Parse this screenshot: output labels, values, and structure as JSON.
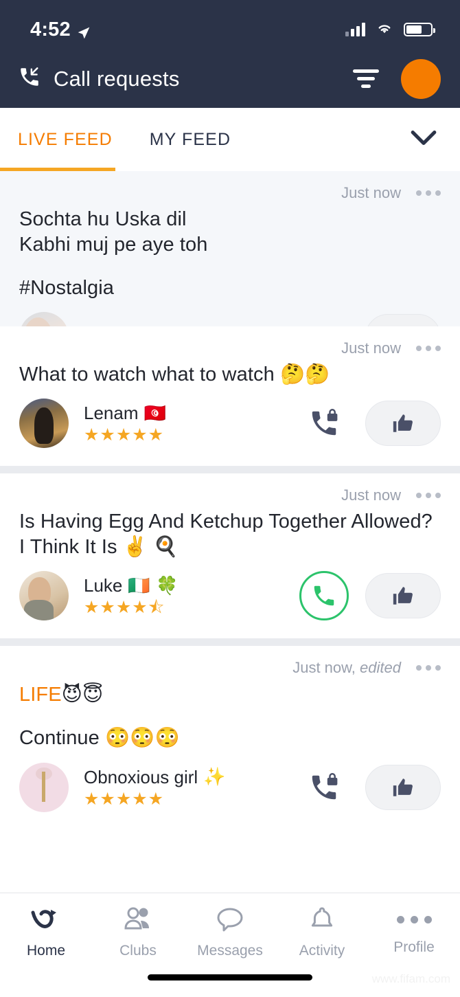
{
  "status_bar": {
    "time": "4:52",
    "location_icon": "location-arrow-icon",
    "signal_icon": "cellular-signal-icon",
    "wifi_icon": "wifi-icon",
    "battery_icon": "battery-icon",
    "battery_level_pct": 65
  },
  "header": {
    "icon": "incoming-call-icon",
    "title": "Call requests",
    "filter_icon": "filter-icon",
    "add_button_icon": "plus-icon",
    "accent_color": "#f57c00",
    "background_color": "#2b3348"
  },
  "tabs": {
    "active_index": 0,
    "items": [
      {
        "label": "LIVE FEED"
      },
      {
        "label": "MY FEED"
      }
    ],
    "expand_icon": "chevron-down-icon",
    "active_color": "#f57c00",
    "underline_color": "#f5a623"
  },
  "feed": {
    "posts": [
      {
        "time": "Just now",
        "edited": "",
        "text_line1": "Sochta hu Uska dil",
        "text_line2": "Kabhi muj pe aye toh",
        "text_line3": "#Nostalgia",
        "clipped": true,
        "dimmed": true,
        "menu_icon": "more-options-icon"
      },
      {
        "time": "Just now",
        "edited": "",
        "text": "What to watch what to watch 🤔🤔",
        "user_name": "Lenam",
        "user_badge": "🇹🇳",
        "rating": 5,
        "rating_label": "★★★★★",
        "call_state": "locked",
        "call_icon": "phone-locked-icon",
        "like_icon": "thumbs-up-icon",
        "menu_icon": "more-options-icon"
      },
      {
        "time": "Just now",
        "edited": "",
        "text": "Is Having Egg And Ketchup Together Allowed? I Think It Is ✌️ 🍳",
        "user_name": "Luke",
        "user_badge": "🇮🇪 🍀",
        "rating": 4.5,
        "rating_label": "★★★★⯪",
        "call_state": "available",
        "call_icon": "phone-call-icon",
        "like_icon": "thumbs-up-icon",
        "menu_icon": "more-options-icon"
      },
      {
        "time": "Just now,",
        "edited": "edited",
        "text_highlight": "LIFE",
        "text_highlight_emoji": "😈😇",
        "text_line2": "Continue 😳😳😳",
        "user_name": "Obnoxious girl",
        "user_badge": "✨",
        "rating": 5,
        "rating_label": "★★★★★",
        "call_state": "locked",
        "call_icon": "phone-locked-icon",
        "like_icon": "thumbs-up-icon",
        "menu_icon": "more-options-icon"
      }
    ]
  },
  "bottom_nav": {
    "active_index": 0,
    "items": [
      {
        "label": "Home",
        "icon": "app-logo-icon"
      },
      {
        "label": "Clubs",
        "icon": "people-icon"
      },
      {
        "label": "Messages",
        "icon": "chat-bubble-icon"
      },
      {
        "label": "Activity",
        "icon": "bell-icon"
      },
      {
        "label": "Profile",
        "icon": "more-dots-icon"
      }
    ]
  },
  "watermark": "www.fifam.com"
}
